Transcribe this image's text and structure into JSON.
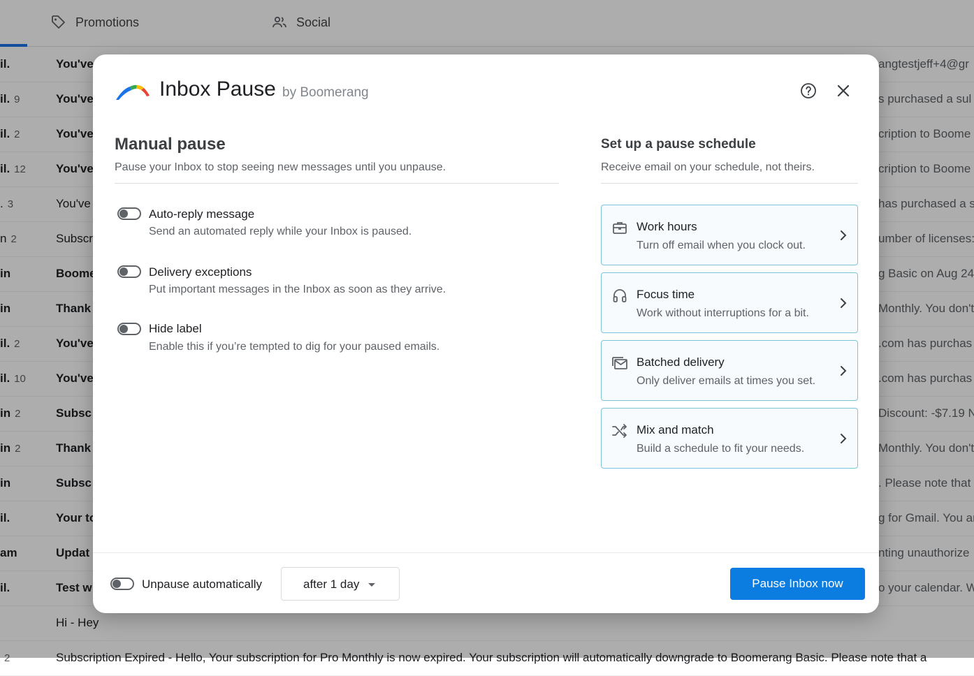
{
  "background": {
    "tabs": [
      {
        "label": "Promotions",
        "icon": "tag-icon"
      },
      {
        "label": "Social",
        "icon": "people-icon"
      }
    ],
    "rows": [
      {
        "sender": "il.",
        "count": "",
        "subject": "You've",
        "tail": "angtestjeff+4@gr",
        "bold": true
      },
      {
        "sender": "il.",
        "count": "9",
        "subject": "You've",
        "tail": "s purchased a sul",
        "bold": true
      },
      {
        "sender": "il.",
        "count": "2",
        "subject": "You've",
        "tail": "cription to Boome",
        "bold": true
      },
      {
        "sender": "il.",
        "count": "12",
        "subject": "You've",
        "tail": "cription to Boome",
        "bold": true
      },
      {
        "sender": ".",
        "count": "3",
        "subject": "You've",
        "tail": "has purchased a s",
        "bold": false
      },
      {
        "sender": "n",
        "count": "2",
        "subject": "Subscr",
        "tail": "umber of licenses:",
        "bold": false
      },
      {
        "sender": "in",
        "count": "",
        "subject": "Boome",
        "tail": "g Basic on Aug 24",
        "bold": true
      },
      {
        "sender": "in",
        "count": "",
        "subject": "Thank",
        "tail": "Monthly. You don't",
        "bold": true
      },
      {
        "sender": "il.",
        "count": "2",
        "subject": "You've",
        "tail": ".com has purchas",
        "bold": true
      },
      {
        "sender": "il.",
        "count": "10",
        "subject": "You've",
        "tail": ".com has purchas",
        "bold": true
      },
      {
        "sender": "in",
        "count": "2",
        "subject": "Subsc",
        "tail": "Discount: -$7.19 N",
        "bold": true
      },
      {
        "sender": "in",
        "count": "2",
        "subject": "Thank",
        "tail": "Monthly. You don't",
        "bold": true
      },
      {
        "sender": "in",
        "count": "",
        "subject": "Subsc",
        "tail": ". Please note that",
        "bold": true
      },
      {
        "sender": "il.",
        "count": "",
        "subject": "Your to",
        "tail": "g for Gmail. You ar",
        "bold": true
      },
      {
        "sender": "am",
        "count": "",
        "subject": "Updat",
        "tail": "nting unauthorize",
        "bold": true
      },
      {
        "sender": "il.",
        "count": "",
        "subject": "Test w",
        "tail": "o your calendar. W",
        "bold": true
      },
      {
        "sender": "",
        "count": "",
        "subject": "Hi - Hey",
        "tail": "",
        "bold": false
      },
      {
        "sender": "",
        "count": "2",
        "subject": "Subscription Expired - Hello, Your subscription for Pro Monthly is now expired. Your subscription will automatically downgrade to Boomerang Basic. Please note that a",
        "tail": "",
        "bold": false
      }
    ]
  },
  "modal": {
    "title": "Inbox Pause",
    "byline": "by Boomerang",
    "manual": {
      "heading": "Manual pause",
      "subtitle": "Pause your Inbox to stop seeing new messages until you unpause.",
      "options": [
        {
          "title": "Auto-reply message",
          "desc": "Send an automated reply while your Inbox is paused.",
          "enabled": false
        },
        {
          "title": "Delivery exceptions",
          "desc": "Put important messages in the Inbox as soon as they arrive.",
          "enabled": false
        },
        {
          "title": "Hide label",
          "desc": "Enable this if you’re tempted to dig for your paused emails.",
          "enabled": false
        }
      ]
    },
    "schedule": {
      "heading": "Set up a pause schedule",
      "subtitle": "Receive email on your schedule, not theirs.",
      "cards": [
        {
          "title": "Work hours",
          "desc": "Turn off email when you clock out.",
          "icon": "briefcase-icon"
        },
        {
          "title": "Focus time",
          "desc": "Work without interruptions for a bit.",
          "icon": "headphones-icon"
        },
        {
          "title": "Batched delivery",
          "desc": "Only deliver emails at times you set.",
          "icon": "batched-mail-icon"
        },
        {
          "title": "Mix and match",
          "desc": "Build a schedule to fit your needs.",
          "icon": "shuffle-icon"
        }
      ]
    },
    "footer": {
      "unpause_label": "Unpause automatically",
      "unpause_enabled": false,
      "duration_value": "after 1 day",
      "primary_button": "Pause Inbox now"
    }
  },
  "colors": {
    "primary": "#0b7de0",
    "card_border": "#7cc5d9",
    "card_bg": "#f7fbfd",
    "overlay": "rgba(0,0,0,0.32)",
    "logo": [
      "#1a73e8",
      "#34a853",
      "#fbbc04",
      "#ea4335"
    ]
  }
}
